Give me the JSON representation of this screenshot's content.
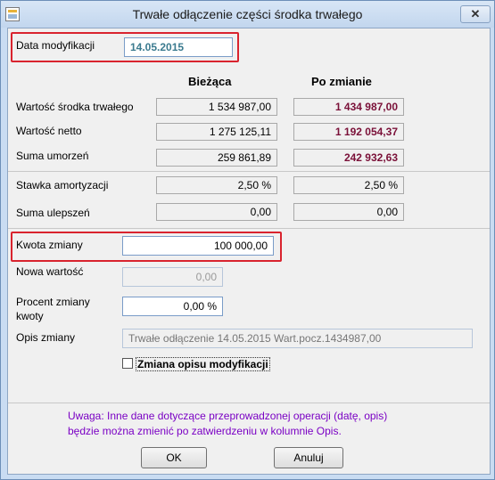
{
  "window": {
    "title": "Trwałe odłączenie części środka trwałego",
    "close_glyph": "✕"
  },
  "data_modyfikacji": {
    "label": "Data modyfikacji",
    "value": "14.05.2015"
  },
  "columns": {
    "current": "Bieżąca",
    "after": "Po zmianie"
  },
  "rows": [
    {
      "label": "Wartość środka trwałego",
      "current": "1 534 987,00",
      "after": "1 434 987,00"
    },
    {
      "label": "Wartość netto",
      "current": "1 275 125,11",
      "after": "1 192 054,37"
    },
    {
      "label": "Suma umorzeń",
      "current": "259 861,89",
      "after": "242 932,63"
    },
    {
      "label": "Stawka amortyzacji",
      "current": "2,50 %",
      "after": "2,50 %"
    },
    {
      "label": "Suma ulepszeń",
      "current": "0,00",
      "after": "0,00"
    }
  ],
  "kwota_zmiany": {
    "label": "Kwota zmiany",
    "value": "100 000,00"
  },
  "nowa_wartosc": {
    "label": "Nowa wartość",
    "value": "0,00"
  },
  "procent_zmiany": {
    "label_line1": "Procent zmiany",
    "label_line2": "kwoty",
    "value": "0,00 %"
  },
  "opis_zmiany": {
    "label": "Opis zmiany",
    "value": "Trwałe odłączenie 14.05.2015 Wart.pocz.1434987,00"
  },
  "checkbox": {
    "label": "Zmiana opisu modyfikacji",
    "checked": false
  },
  "warning": {
    "line1": "Uwaga: Inne dane dotyczące przeprowadzonej operacji (datę, opis)",
    "line2": "będzie można zmienić po zatwierdzeniu w kolumnie Opis."
  },
  "buttons": {
    "ok": "OK",
    "cancel": "Anuluj"
  },
  "colors": {
    "after_values": "#7a1038",
    "warning_text": "#7a00c4",
    "highlight_box": "#d9232e"
  }
}
